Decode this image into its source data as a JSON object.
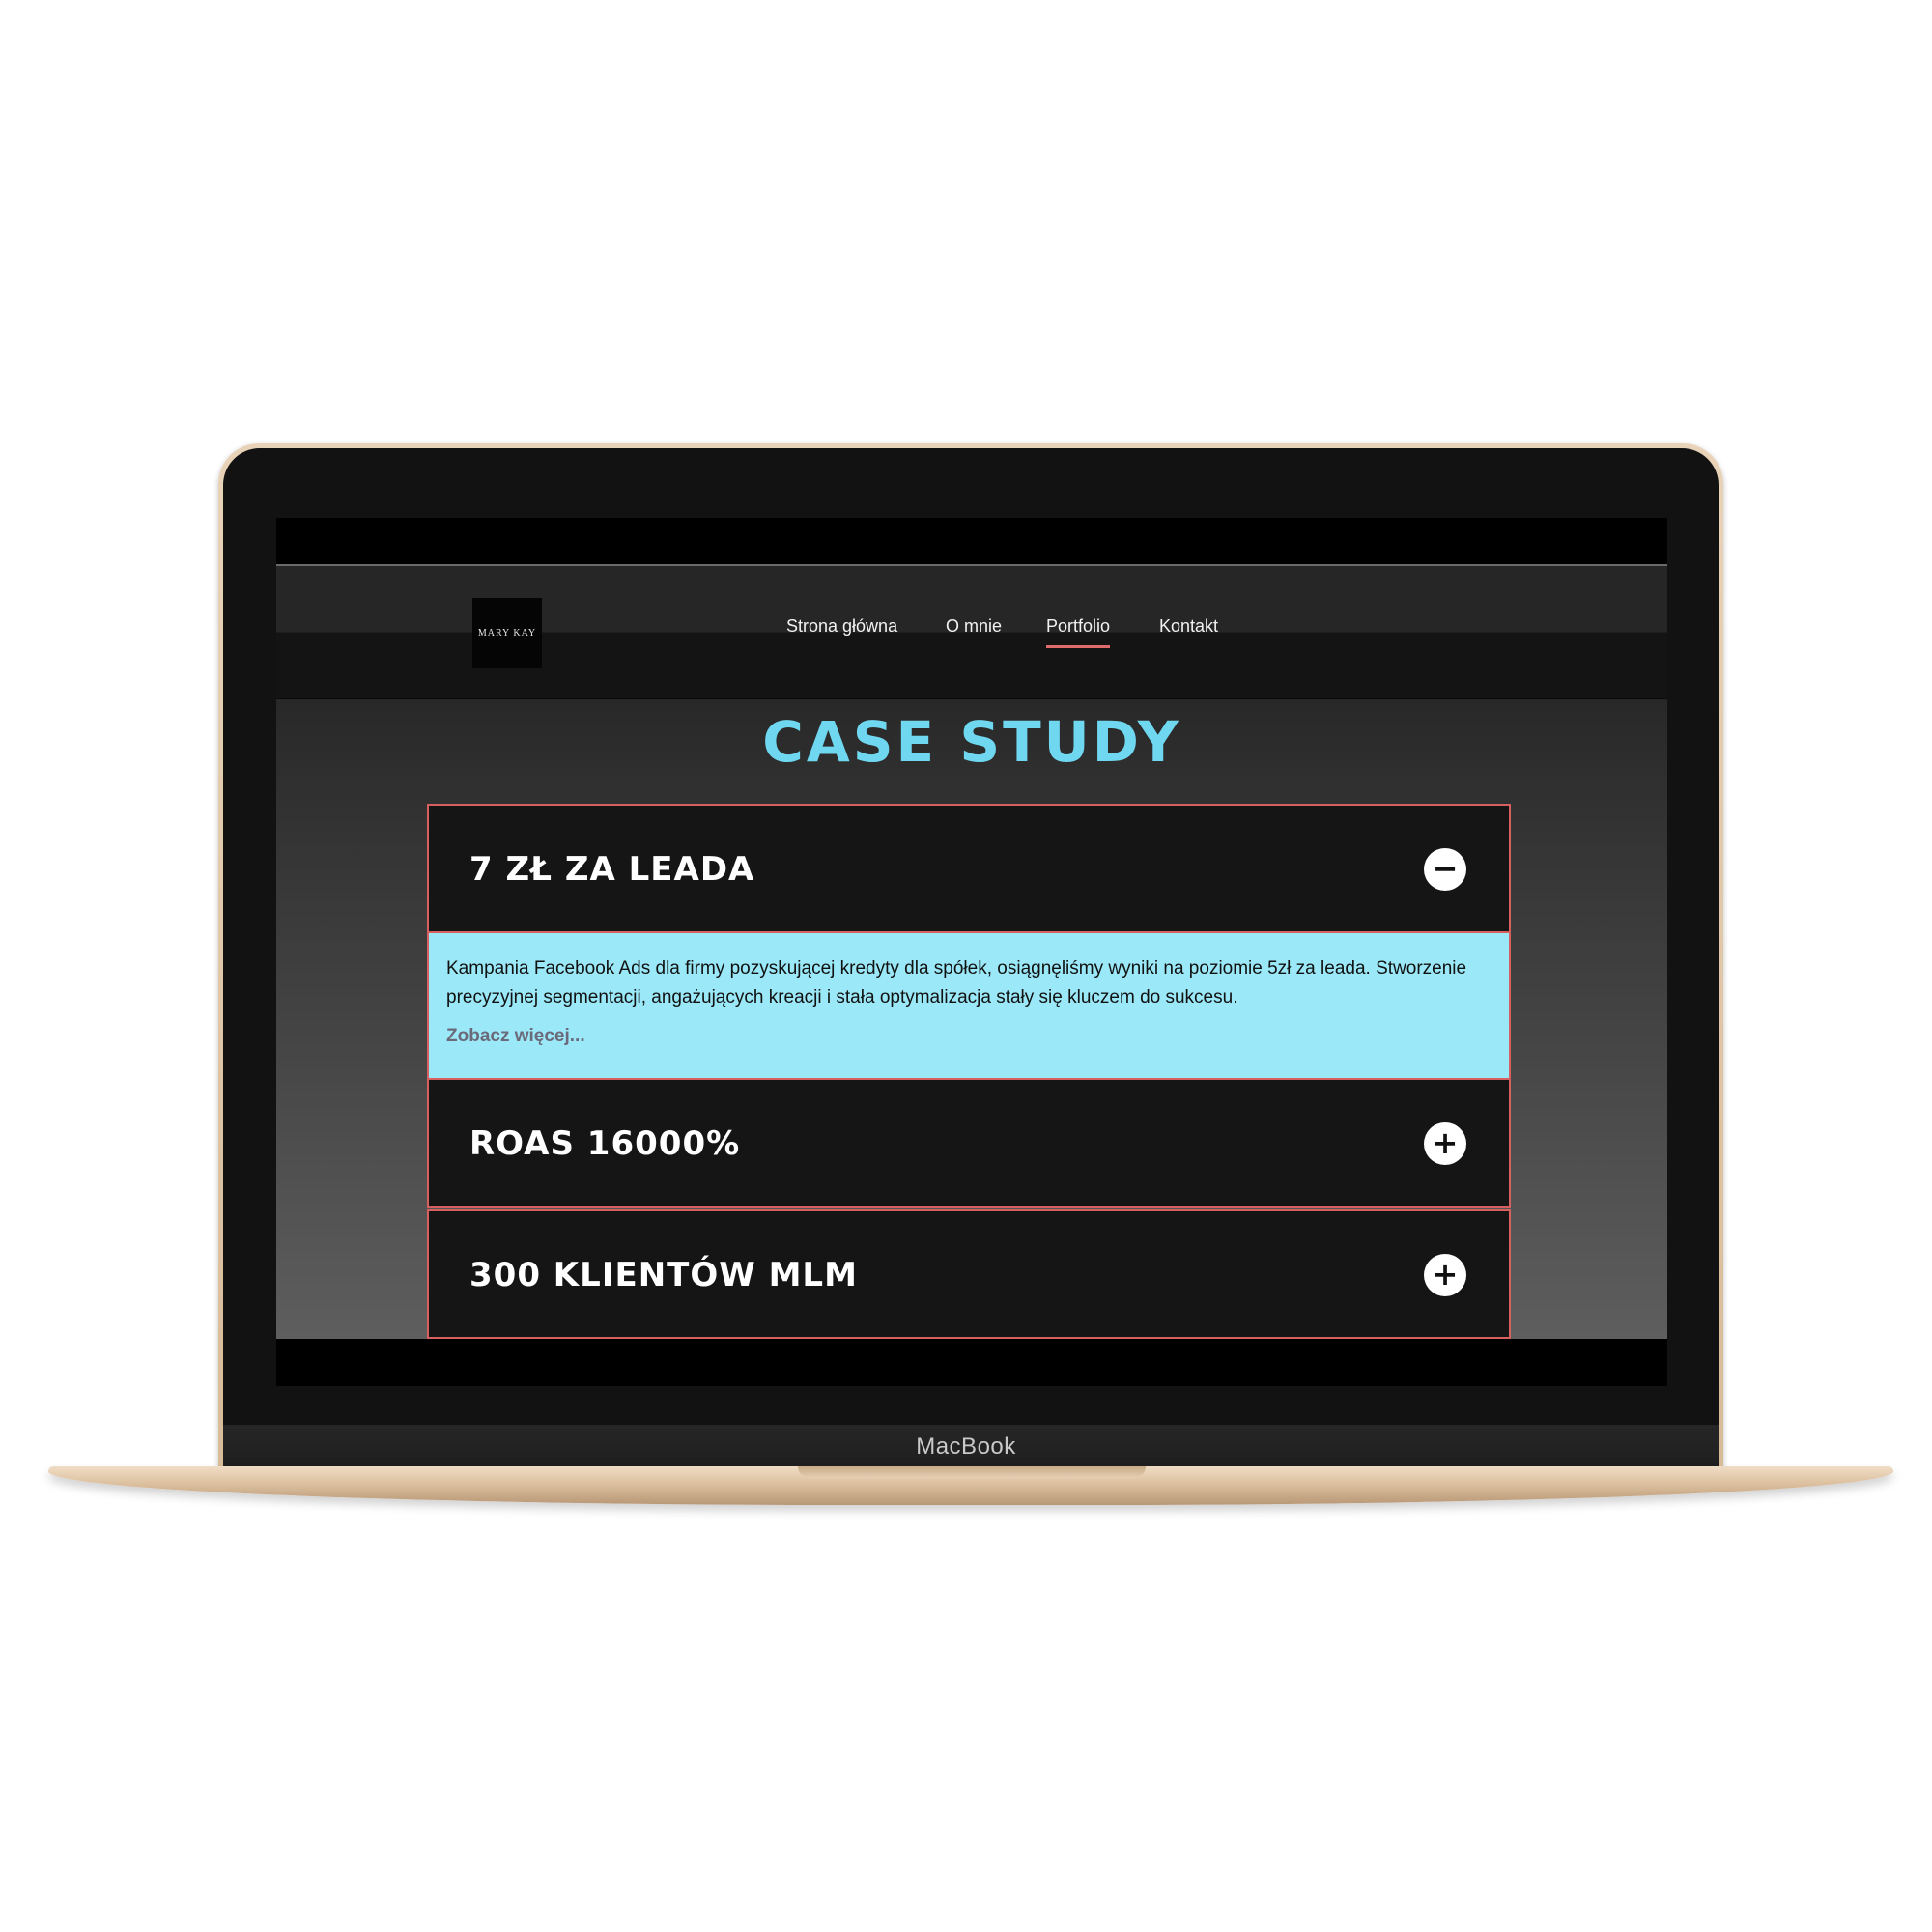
{
  "device": {
    "label": "MacBook"
  },
  "logo": {
    "text": "MARY KAY"
  },
  "nav": {
    "items": [
      {
        "label": "Strona główna",
        "active": false
      },
      {
        "label": "O mnie",
        "active": false
      },
      {
        "label": "Portfolio",
        "active": true
      },
      {
        "label": "Kontakt",
        "active": false
      }
    ]
  },
  "page": {
    "title": "CASE STUDY"
  },
  "accordion": {
    "items": [
      {
        "title": "7 ZŁ ZA LEADA",
        "expanded": true,
        "toggle": "−",
        "body": "Kampania Facebook Ads dla firmy pozyskującej kredyty dla spółek, osiągnęliśmy wyniki na poziomie 5zł za leada. Stworzenie precyzyjnej segmentacji, angażujących kreacji i stała optymalizacja stały się kluczem do sukcesu.",
        "more": "Zobacz więcej..."
      },
      {
        "title": "ROAS 16000%",
        "expanded": false,
        "toggle": "+"
      },
      {
        "title": "300 KLIENTÓW MLM",
        "expanded": false,
        "toggle": "+"
      }
    ]
  },
  "colors": {
    "accent": "#6fd7f0",
    "border": "#d65f5f",
    "panel": "#151515",
    "body_bg": "#9be9f8"
  }
}
